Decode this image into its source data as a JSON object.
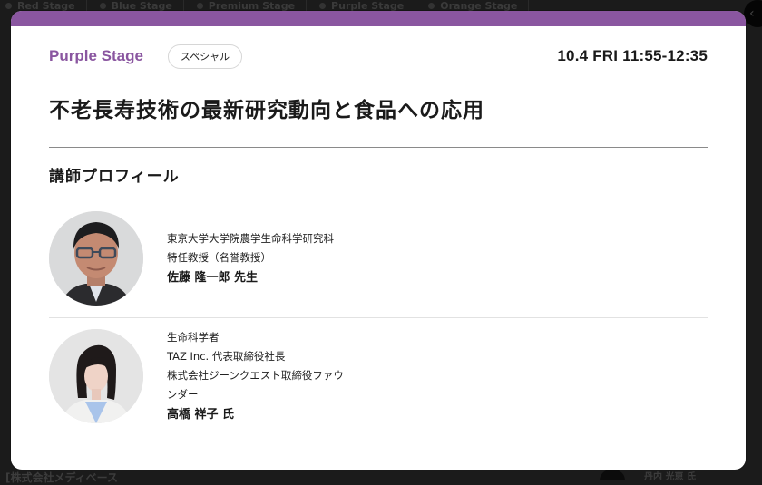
{
  "background": {
    "stage_tabs": [
      {
        "label": "Red Stage"
      },
      {
        "label": "Blue Stage"
      },
      {
        "label": "Premium Stage"
      },
      {
        "label": "Purple Stage"
      },
      {
        "label": "Orange Stage"
      }
    ],
    "bottom_left_text": "[株式会社メディベース",
    "bottom_right_text": "丹内 光恵 氏"
  },
  "modal": {
    "accent_color": "#8a56a0",
    "stage_name": "Purple Stage",
    "tag": "スペシャル",
    "datetime": "10.4 FRI 11:55-12:35",
    "title": "不老長寿技術の最新研究動向と食品への応用",
    "section_title": "講師プロフィール",
    "speakers": [
      {
        "affiliation_lines": [
          "東京大学大学院農学生命科学研究科",
          "特任教授（名誉教授）"
        ],
        "name": "佐藤 隆一郎 先生"
      },
      {
        "affiliation_lines": [
          "生命科学者",
          "TAZ Inc. 代表取締役社長",
          "株式会社ジーンクエスト取締役ファウ",
          "ンダー"
        ],
        "name": "高橋 祥子 氏"
      }
    ]
  }
}
